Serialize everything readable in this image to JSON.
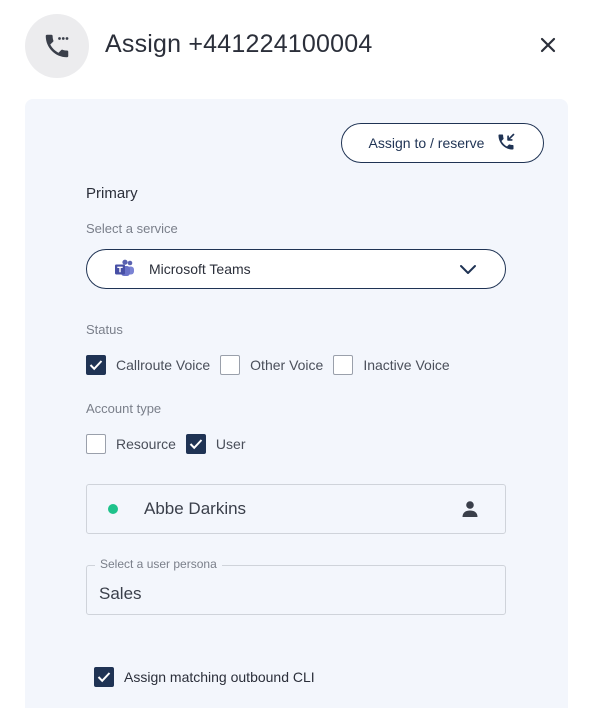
{
  "header": {
    "title": "Assign +441224100004",
    "icon": "phone-icon",
    "close_icon": "close-icon"
  },
  "actions": {
    "assign_reserve_label": "Assign to / reserve",
    "assign_reserve_icon": "phone-incoming-icon"
  },
  "primary": {
    "section_label": "Primary",
    "service_label": "Select a service",
    "service_value": "Microsoft Teams",
    "service_icon": "teams-icon"
  },
  "status": {
    "label": "Status",
    "options": [
      {
        "label": "Callroute Voice",
        "checked": true
      },
      {
        "label": "Other Voice",
        "checked": false
      },
      {
        "label": "Inactive Voice",
        "checked": false
      }
    ]
  },
  "account_type": {
    "label": "Account type",
    "options": [
      {
        "label": "Resource",
        "checked": false
      },
      {
        "label": "User",
        "checked": true
      }
    ]
  },
  "user": {
    "name": "Abbe Darkins",
    "status_color": "#1ec28b"
  },
  "persona": {
    "label": "Select a user persona",
    "value": "Sales"
  },
  "cli": {
    "label": "Assign matching outbound CLI",
    "checked": true
  },
  "colors": {
    "accent": "#1f3354",
    "panel_bg": "#f3f6fc"
  }
}
